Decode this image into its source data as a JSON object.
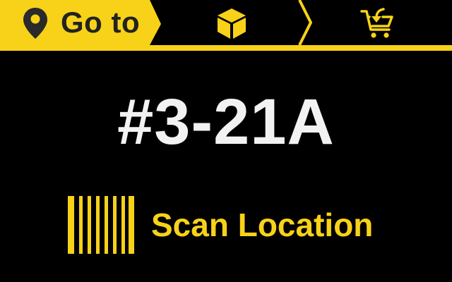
{
  "header": {
    "steps": [
      {
        "id": "goto",
        "label": "Go to",
        "icon": "location-pin-icon",
        "state": "active"
      },
      {
        "id": "pick",
        "icon": "box-icon",
        "state": "pending"
      },
      {
        "id": "return",
        "icon": "cart-return-icon",
        "state": "pending"
      }
    ]
  },
  "main": {
    "location_code": "#3-21A",
    "scan_prompt": "Scan Location",
    "scan_icon": "barcode-icon"
  },
  "colors": {
    "accent": "#f7d218",
    "background": "#000000",
    "text_primary": "#f2f2f2",
    "text_dark": "#222222"
  }
}
